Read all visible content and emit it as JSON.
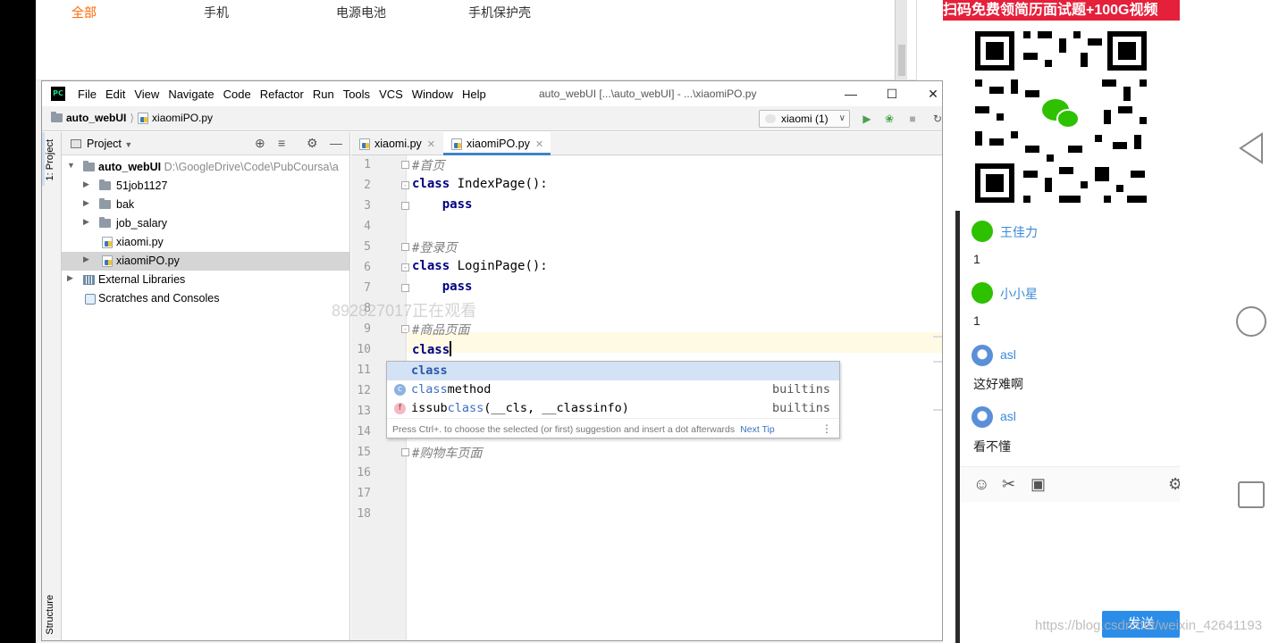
{
  "webpage": {
    "categories": [
      "全部",
      "手机",
      "电源电池",
      "手机保护壳"
    ],
    "active_category": "全部"
  },
  "ide": {
    "logo": "PC",
    "menu": [
      "File",
      "Edit",
      "View",
      "Navigate",
      "Code",
      "Refactor",
      "Run",
      "Tools",
      "VCS",
      "Window",
      "Help"
    ],
    "window_title": "auto_webUI [...\\auto_webUI] - ...\\xiaomiPO.py",
    "breadcrumb": {
      "project": "auto_webUI",
      "file": "xiaomiPO.py"
    },
    "run_config": "xiaomi (1)",
    "tool_strip": {
      "project_tab": "1: Project",
      "structure_tab": "Structure"
    },
    "project_panel": {
      "title": "Project",
      "root": {
        "name": "auto_webUI",
        "path": "D:\\GoogleDrive\\Code\\PubCoursa\\a"
      },
      "items": [
        {
          "name": "51job1127",
          "type": "folder"
        },
        {
          "name": "bak",
          "type": "folder"
        },
        {
          "name": "job_salary",
          "type": "folder"
        },
        {
          "name": "xiaomi.py",
          "type": "py"
        },
        {
          "name": "xiaomiPO.py",
          "type": "py",
          "selected": true
        }
      ],
      "external_libraries": "External Libraries",
      "scratches": "Scratches and Consoles"
    },
    "tabs": [
      {
        "label": "xiaomi.py",
        "active": false
      },
      {
        "label": "xiaomiPO.py",
        "active": true
      }
    ],
    "code": {
      "line_numbers": [
        "1",
        "2",
        "3",
        "4",
        "5",
        "6",
        "7",
        "8",
        "9",
        "10",
        "11",
        "12",
        "13",
        "14",
        "15",
        "16",
        "17",
        "18"
      ],
      "comment1": "#首页",
      "class_kw": "class",
      "class1_rest": " IndexPage():",
      "pass_kw": "pass",
      "comment2": "#登录页",
      "class2_rest": " LoginPage():",
      "comment3": "#商品页面",
      "typed": "class",
      "comment4": "#购物车页面"
    },
    "watermark": "892827017正在观看",
    "completion": {
      "items": [
        {
          "badge": "",
          "match": "class",
          "rest": "",
          "source": ""
        },
        {
          "badge": "c",
          "match": "class",
          "rest": "method",
          "source": "builtins"
        },
        {
          "badge": "f",
          "prefix": "issub",
          "match": "class",
          "rest": "(__cls, __classinfo)",
          "source": "builtins"
        }
      ],
      "tip": "Press Ctrl+. to choose the selected (or first) suggestion and insert a dot afterwards",
      "tip_link": "Next Tip"
    }
  },
  "chat": {
    "banner": "扫码免费领简历面试题+100G视频",
    "messages": [
      {
        "user": "王佳力",
        "avatar": "wechat",
        "text": "1"
      },
      {
        "user": "小小星",
        "avatar": "wechat",
        "text": "1"
      },
      {
        "user": "asl",
        "avatar": "qq",
        "text": "这好难啊"
      },
      {
        "user": "asl",
        "avatar": "qq",
        "text": "看不懂"
      }
    ],
    "send_label": "发送",
    "colors": {
      "banner": "#e5203b",
      "send": "#2c8de8",
      "username": "#3a8ad8"
    }
  },
  "footer_watermark": "https://blog.csdn.net/weixin_42641193"
}
